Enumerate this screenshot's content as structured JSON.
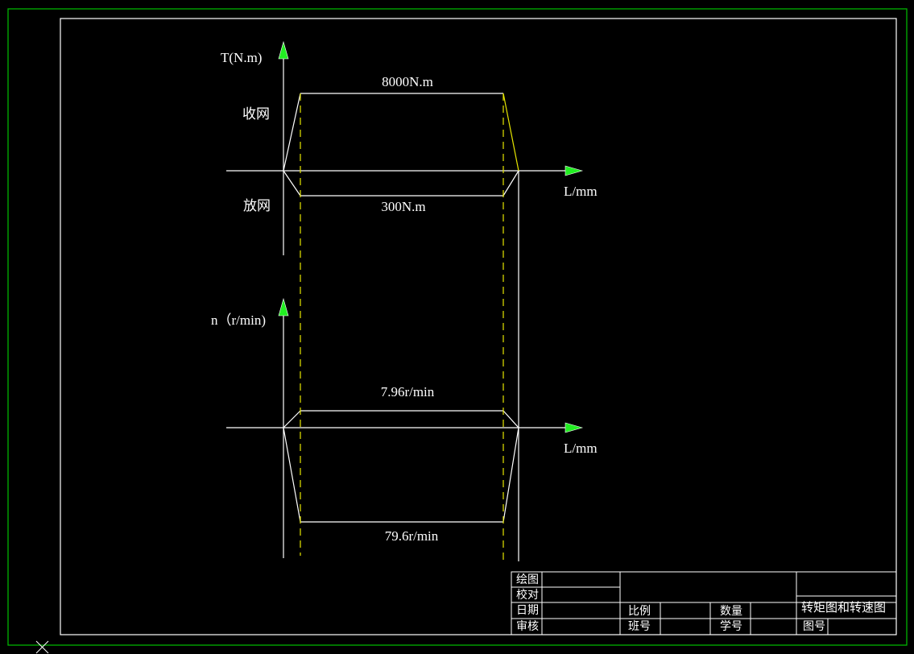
{
  "colors": {
    "background": "#000000",
    "line": "#ffffff",
    "frame_outer": "#00c000",
    "guide": "#e6e600",
    "arrow": "#22ee22"
  },
  "torque_chart": {
    "y_axis_label": "T(N.m)",
    "x_axis_label": "L/mm",
    "upper_value_label": "8000N.m",
    "lower_value_label": "300N.m",
    "upper_region_label": "收网",
    "lower_region_label": "放网"
  },
  "speed_chart": {
    "y_axis_label": "n（r/min)",
    "x_axis_label": "L/mm",
    "upper_value_label": "7.96r/min",
    "lower_value_label": "79.6r/min"
  },
  "title_block": {
    "drawn_by": "绘图",
    "checked_by": "校对",
    "date": "日期",
    "approved_by": "审核",
    "scale": "比例",
    "quantity": "数量",
    "class_no": "班号",
    "student_no": "学号",
    "drawing_title": "转矩图和转速图",
    "drawing_no": "图号"
  }
}
